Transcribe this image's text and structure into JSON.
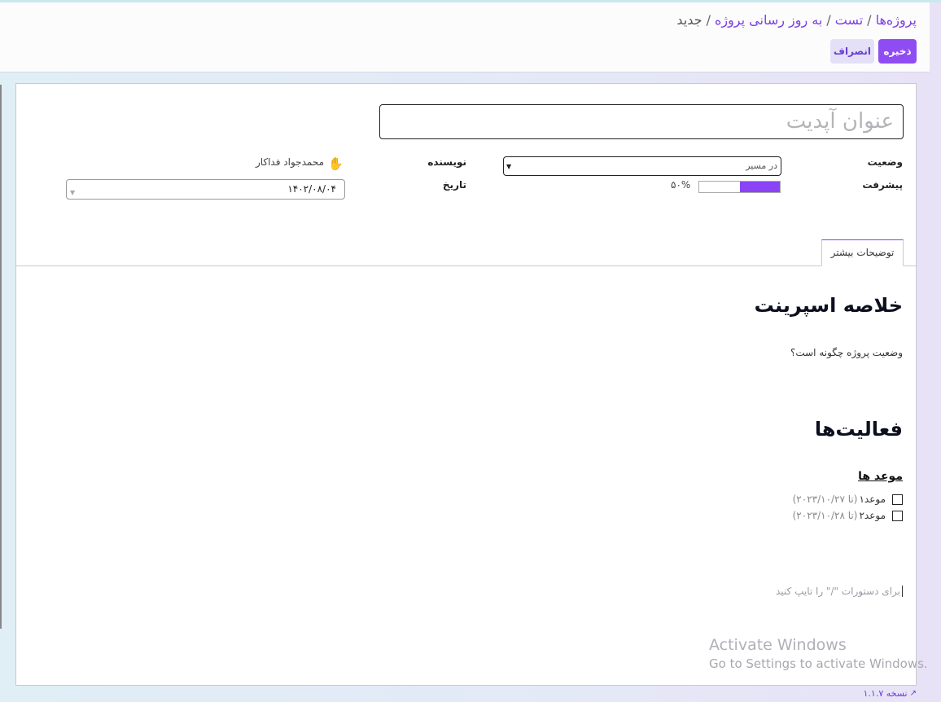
{
  "breadcrumb": {
    "items": [
      "پروژه‌ها",
      "تست",
      "به روز رسانی پروژه"
    ],
    "current": "جدید",
    "separator": "/"
  },
  "actions": {
    "save_label": "ذخیره",
    "cancel_label": "انصراف"
  },
  "form": {
    "title_placeholder": "عنوان آپدیت",
    "status_label": "وضعیت",
    "status_value": "در مسیر",
    "progress_label": "پیشرفت",
    "progress_value": 50,
    "progress_text": "۵۰%",
    "author_label": "نویسنده",
    "author_name": "محمدجواد فداکار",
    "author_icon": "hand-avatar-icon",
    "date_label": "تاریخ",
    "date_value": "۱۴۰۲/۰۸/۰۴"
  },
  "tabs": [
    {
      "label": "توضیحات بیشتر"
    }
  ],
  "content": {
    "summary_heading": "خلاصه اسپرینت",
    "summary_question": "وضعیت پروژه چگونه است؟",
    "activities_heading": "فعالیت‌ها",
    "deadlines_heading": "موعد ها",
    "todos": [
      {
        "label": "موعد۱",
        "deadline": "(تا ۲۰۲۳/۱۰/۲۷)"
      },
      {
        "label": "موعد۲",
        "deadline": "(تا ۲۰۲۳/۱۰/۲۸)"
      }
    ],
    "editor_placeholder": "برای دستورات \"/\" را تایپ کنید"
  },
  "watermark": {
    "title": "Activate Windows",
    "subtitle": "Go to Settings to activate Windows."
  },
  "footer": {
    "version_text": "نسخه ۱.۱.۷"
  },
  "colors": {
    "accent": "#8f4cf3",
    "progress": "#8a43f5"
  }
}
